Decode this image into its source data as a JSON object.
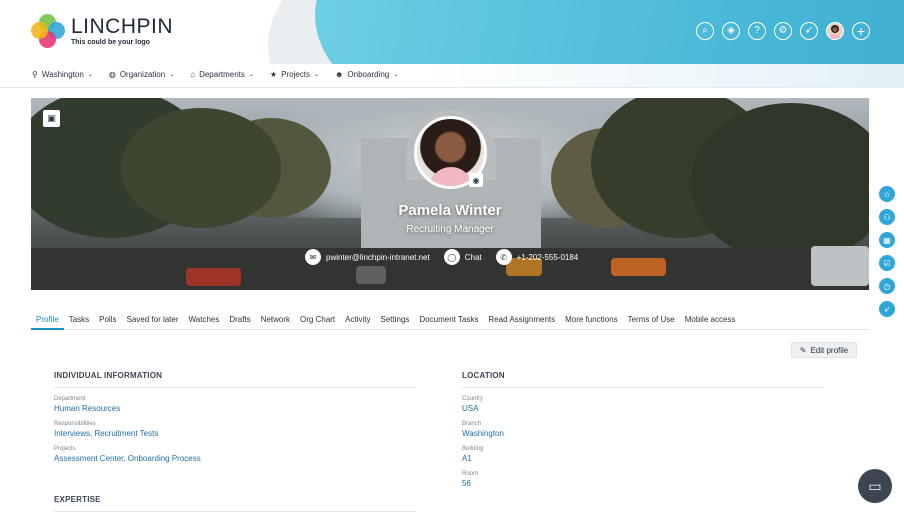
{
  "brand": {
    "name": "LINCHPIN",
    "tagline": "This could be your logo"
  },
  "header_icons": [
    {
      "name": "search-icon",
      "glyph": "⌕"
    },
    {
      "name": "compass-icon",
      "glyph": "◈"
    },
    {
      "name": "help-icon",
      "glyph": "?"
    },
    {
      "name": "settings-icon",
      "glyph": "⚙"
    },
    {
      "name": "rocket-icon",
      "glyph": "➶"
    },
    {
      "name": "user-avatar-icon",
      "glyph": ""
    },
    {
      "name": "add-icon",
      "glyph": "+"
    }
  ],
  "nav": [
    {
      "icon": "location-pin-icon",
      "glyph": "⚲",
      "label": "Washington"
    },
    {
      "icon": "globe-icon",
      "glyph": "◍",
      "label": "Organization"
    },
    {
      "icon": "home-icon",
      "glyph": "⌂",
      "label": "Departments"
    },
    {
      "icon": "star-icon",
      "glyph": "★",
      "label": "Projects"
    },
    {
      "icon": "people-icon",
      "glyph": "☻",
      "label": "Onboarding"
    }
  ],
  "profile": {
    "name": "Pamela Winter",
    "role": "Recruiting Manager",
    "email": "pwinter@linchpin-intranet.net",
    "chat_label": "Chat",
    "phone": "+1-202-555-0184"
  },
  "tabs": [
    "Profile",
    "Tasks",
    "Polls",
    "Saved for later",
    "Watches",
    "Drafts",
    "Network",
    "Org Chart",
    "Activity",
    "Settings",
    "Document Tasks",
    "Read Assignments",
    "More functions",
    "Terms of Use",
    "Mobile access"
  ],
  "active_tab": "Profile",
  "edit_profile_label": "Edit profile",
  "individual": {
    "title": "INDIVIDUAL INFORMATION",
    "fields": [
      {
        "label": "Department",
        "value": "Human Resources"
      },
      {
        "label": "Responsibilities",
        "value": "Interviews, Recruitment Tests"
      },
      {
        "label": "Projects",
        "value": "Assessment Center, Onboarding Process"
      }
    ]
  },
  "expertise": {
    "title": "EXPERTISE"
  },
  "location": {
    "title": "LOCATION",
    "fields": [
      {
        "label": "Country",
        "value": "USA"
      },
      {
        "label": "Branch",
        "value": "Washington"
      },
      {
        "label": "Building",
        "value": "A1"
      },
      {
        "label": "Room",
        "value": "56"
      }
    ]
  },
  "rail": [
    {
      "name": "favorites-icon",
      "glyph": "☆"
    },
    {
      "name": "team-icon",
      "glyph": "⚇"
    },
    {
      "name": "apps-icon",
      "glyph": "▦"
    },
    {
      "name": "tasks-icon",
      "glyph": "☑"
    },
    {
      "name": "history-icon",
      "glyph": "◷"
    },
    {
      "name": "launch-icon",
      "glyph": "➶"
    }
  ],
  "colors": {
    "accent": "#1d8fc7",
    "header_blue": "#46b6d6",
    "text": "#2b3440"
  }
}
